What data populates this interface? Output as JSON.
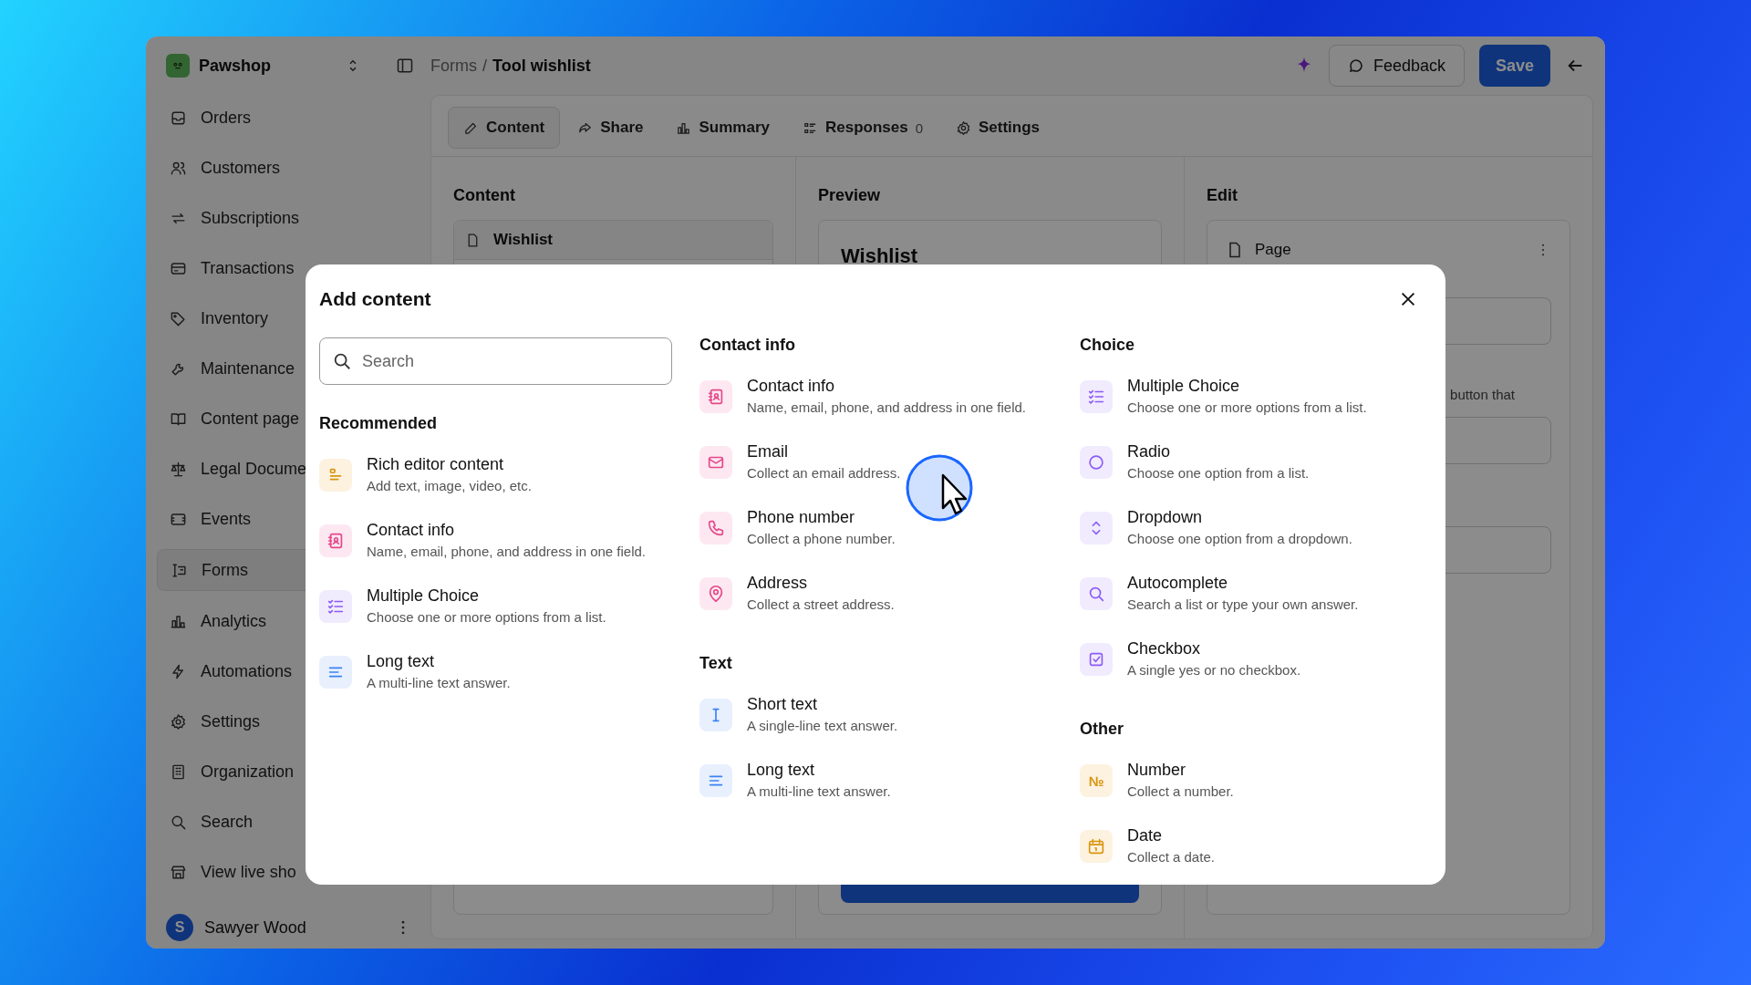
{
  "app": {
    "workspace": "Pawshop",
    "breadcrumb": [
      "Forms",
      "Tool wishlist"
    ],
    "breadcrumb_separator": "/",
    "feedback": "Feedback",
    "save": "Save"
  },
  "sidebar": {
    "items": [
      {
        "label": "Orders",
        "selected": false
      },
      {
        "label": "Customers",
        "selected": false
      },
      {
        "label": "Subscriptions",
        "selected": false
      },
      {
        "label": "Transactions",
        "selected": false
      },
      {
        "label": "Inventory",
        "selected": false
      },
      {
        "label": "Maintenance",
        "selected": false
      },
      {
        "label": "Content page",
        "selected": false
      },
      {
        "label": "Legal Docume",
        "selected": false
      },
      {
        "label": "Events",
        "selected": false
      },
      {
        "label": "Forms",
        "selected": true
      },
      {
        "label": "Analytics",
        "selected": false
      },
      {
        "label": "Automations",
        "selected": false
      },
      {
        "label": "Settings",
        "selected": false
      },
      {
        "label": "Organization",
        "selected": false
      },
      {
        "label": "Search",
        "selected": false
      },
      {
        "label": "View live sho",
        "selected": false
      }
    ],
    "user": {
      "initial": "S",
      "name": "Sawyer Wood"
    }
  },
  "tabs": [
    {
      "label": "Content",
      "selected": true
    },
    {
      "label": "Share",
      "selected": false
    },
    {
      "label": "Summary",
      "selected": false
    },
    {
      "label": "Responses",
      "count": "0",
      "selected": false
    },
    {
      "label": "Settings",
      "selected": false
    }
  ],
  "panels": {
    "content": {
      "title": "Content",
      "item": "Wishlist"
    },
    "preview": {
      "title": "Preview",
      "heading": "Wishlist"
    },
    "edit": {
      "title": "Edit",
      "item": "Page",
      "text": "button that"
    }
  },
  "dialog": {
    "title": "Add content",
    "search": {
      "placeholder": "Search"
    },
    "columns": [
      [
        {
          "title": "Recommended",
          "items": [
            {
              "kind": "rich",
              "title": "Rich editor content",
              "description": "Add text, image, video, etc."
            },
            {
              "kind": "contact",
              "title": "Contact info",
              "description": "Name, email, phone, and address in one field."
            },
            {
              "kind": "multiple",
              "title": "Multiple Choice",
              "description": "Choose one or more options from a list."
            },
            {
              "kind": "longtext",
              "title": "Long text",
              "description": "A multi-line text answer."
            }
          ]
        }
      ],
      [
        {
          "title": "Contact info",
          "items": [
            {
              "kind": "contact",
              "title": "Contact info",
              "description": "Name, email, phone, and address in one field."
            },
            {
              "kind": "email",
              "title": "Email",
              "description": "Collect an email address."
            },
            {
              "kind": "phone",
              "title": "Phone number",
              "description": "Collect a phone number."
            },
            {
              "kind": "address",
              "title": "Address",
              "description": "Collect a street address."
            }
          ]
        },
        {
          "title": "Text",
          "items": [
            {
              "kind": "shorttext",
              "title": "Short text",
              "description": "A single-line text answer."
            },
            {
              "kind": "longtext",
              "title": "Long text",
              "description": "A multi-line text answer."
            }
          ]
        }
      ],
      [
        {
          "title": "Choice",
          "items": [
            {
              "kind": "multiple",
              "title": "Multiple Choice",
              "description": "Choose one or more options from a list."
            },
            {
              "kind": "radio",
              "title": "Radio",
              "description": "Choose one option from a list."
            },
            {
              "kind": "dropdown",
              "title": "Dropdown",
              "description": "Choose one option from a dropdown."
            },
            {
              "kind": "autocomplete",
              "title": "Autocomplete",
              "description": "Search a list or type your own answer."
            },
            {
              "kind": "checkbox",
              "title": "Checkbox",
              "description": "A single yes or no checkbox."
            }
          ]
        },
        {
          "title": "Other",
          "items": [
            {
              "kind": "number",
              "icon_glyph": "№",
              "title": "Number",
              "description": "Collect a number."
            },
            {
              "kind": "date",
              "title": "Date",
              "description": "Collect a date."
            }
          ]
        }
      ]
    ]
  }
}
